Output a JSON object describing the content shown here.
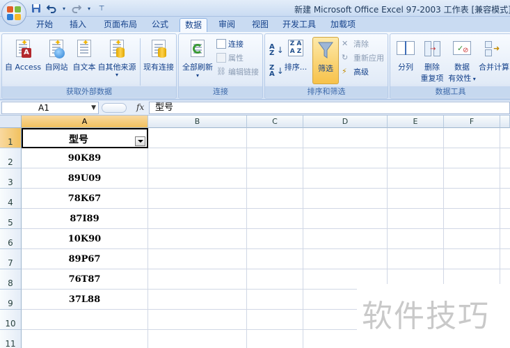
{
  "window": {
    "title": "新建 Microsoft Office Excel 97-2003 工作表  [兼容模式] - M"
  },
  "quick_access": {
    "save_icon": "save-icon",
    "undo_icon": "undo-icon",
    "redo_icon": "redo-icon",
    "customize_icon": "customize-icon"
  },
  "tabs": [
    "开始",
    "插入",
    "页面布局",
    "公式",
    "数据",
    "审阅",
    "视图",
    "开发工具",
    "加载项"
  ],
  "active_tab": "数据",
  "ribbon": {
    "groups": {
      "external": "获取外部数据",
      "connections": "连接",
      "sort_filter": "排序和筛选",
      "data_tools": "数据工具"
    },
    "external": {
      "from_access": "自 Access",
      "from_web": "自网站",
      "from_text": "自文本",
      "from_other": "自其他来源",
      "existing": "现有连接"
    },
    "connections": {
      "refresh_all": "全部刷新",
      "connect": "连接",
      "properties": "属性",
      "edit_links": "编辑链接"
    },
    "sort_filter": {
      "sort": "排序...",
      "filter": "筛选",
      "clear": "清除",
      "reapply": "重新应用",
      "advanced": "高级"
    },
    "data_tools": {
      "text_to_columns": "分列",
      "remove_duplicates_1": "删除",
      "remove_duplicates_2": "重复项",
      "validation_1": "数据",
      "validation_2": "有效性",
      "consolidate": "合并计算"
    }
  },
  "formula_bar": {
    "name_box": "A1",
    "fx": "fx",
    "content": "型号"
  },
  "sheet": {
    "columns": [
      "A",
      "B",
      "C",
      "D",
      "E",
      "F"
    ],
    "rows": [
      "1",
      "2",
      "3",
      "4",
      "5",
      "6",
      "7",
      "8",
      "9",
      "10",
      "11"
    ],
    "header_cell": "型号",
    "values": [
      "90K89",
      "89U09",
      "78K67",
      "87I89",
      "10K90",
      "89P67",
      "76T87",
      "37L88"
    ]
  },
  "watermark": "软件技巧"
}
